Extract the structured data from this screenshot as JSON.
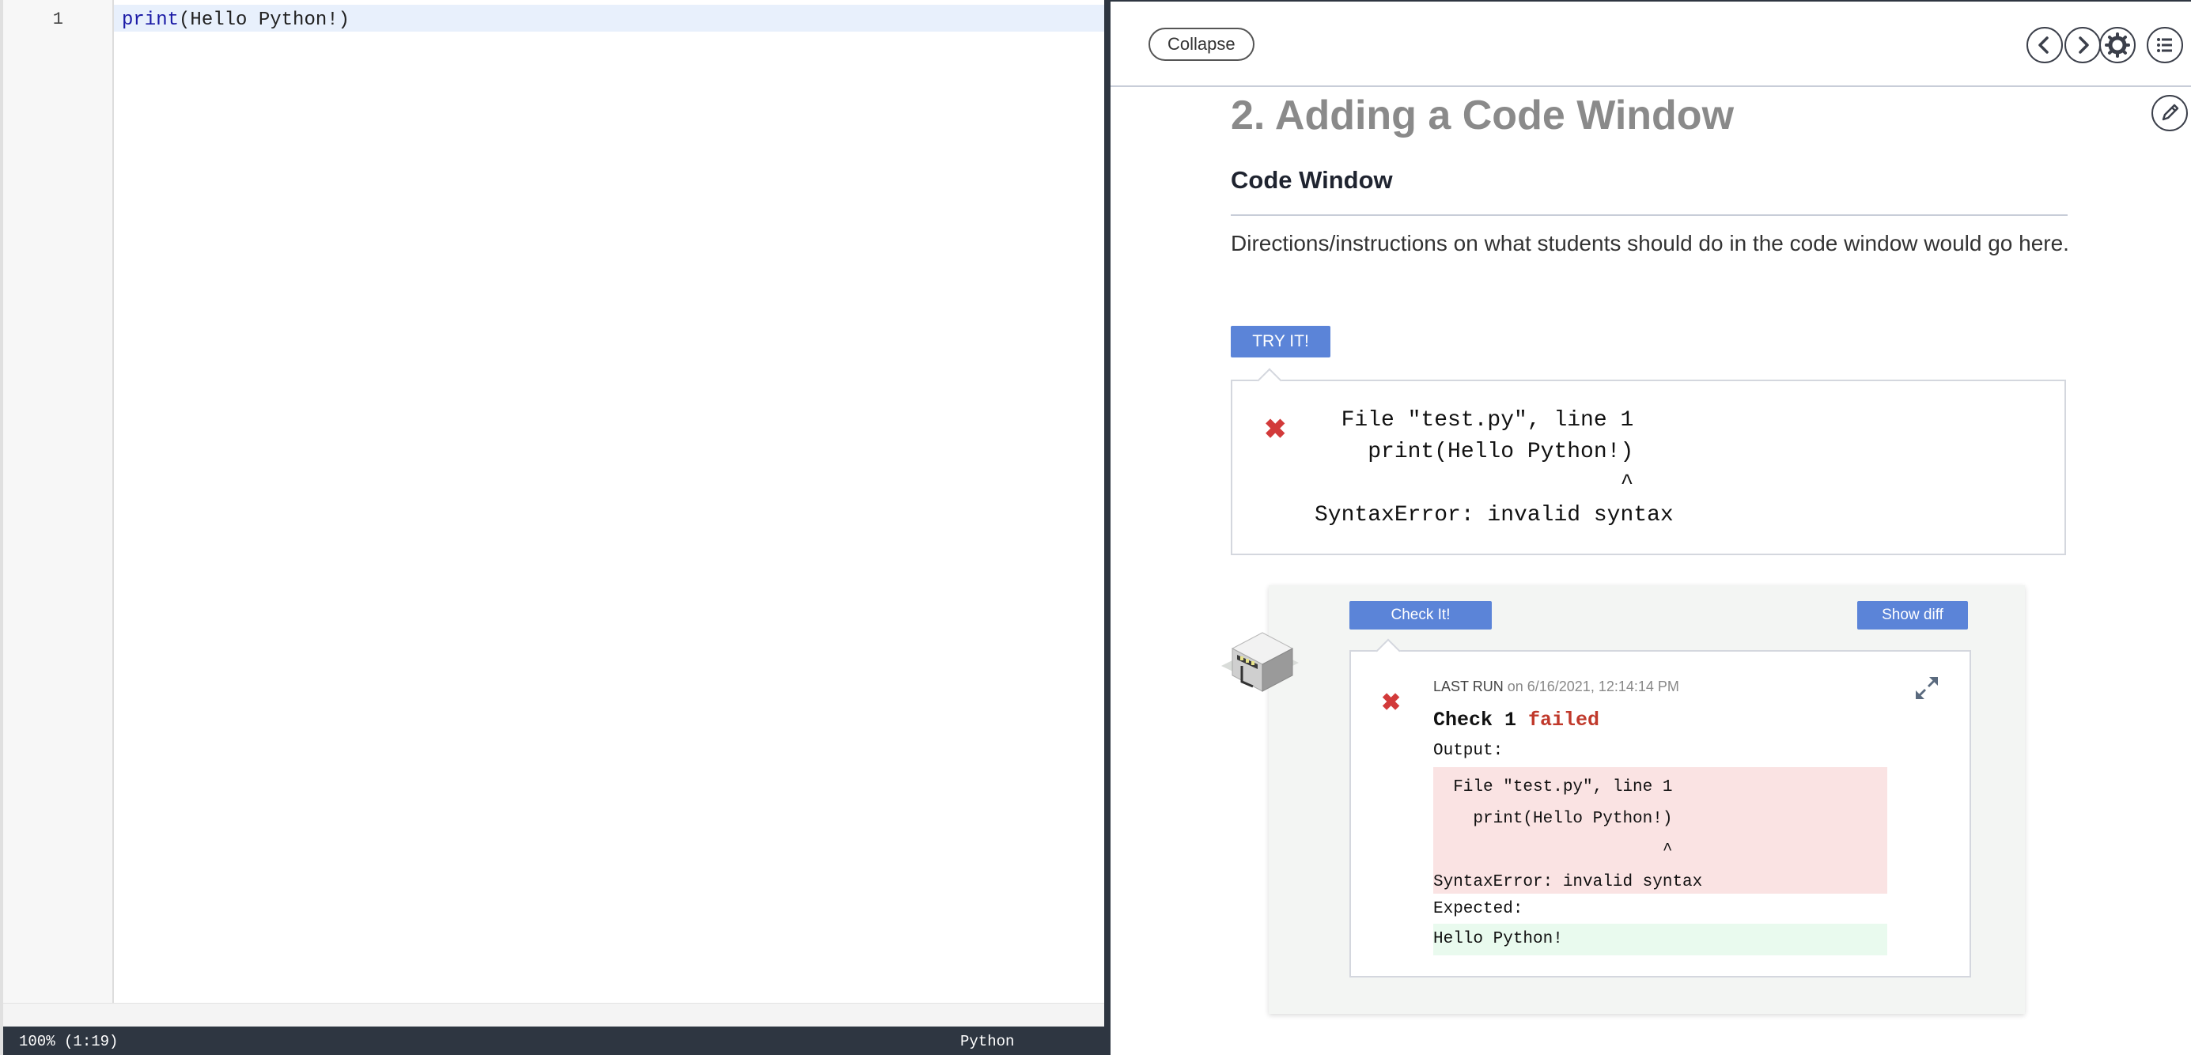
{
  "editor": {
    "line_number": "1",
    "code_keyword": "print",
    "code_rest": "(Hello Python!)",
    "status_zoom": "100%  (1:19)",
    "status_language": "Python"
  },
  "lesson": {
    "collapse_label": "Collapse",
    "section_title": "2. Adding a Code Window",
    "subsection_title": "Code Window",
    "directions": "Directions/instructions on what students should do in the code window would go here.",
    "try_label": "TRY IT!",
    "try_output": "  File \"test.py\", line 1\n    print(Hello Python!)\n                       ^\nSyntaxError: invalid syntax",
    "check_label": "Check It!",
    "diff_label": "Show diff",
    "last_run_label": "LAST RUN",
    "last_run_time": "on 6/16/2021, 12:14:14 PM",
    "check_name": "Check 1",
    "check_status": "failed",
    "output_label": "Output:",
    "output_text": "  File \"test.py\", line 1\n    print(Hello Python!)\n                       ^\nSyntaxError: invalid syntax",
    "expected_label": "Expected:",
    "expected_text": "Hello Python!"
  },
  "icons": {
    "prev": "chevron-left-icon",
    "next": "chevron-right-icon",
    "settings": "gear-icon",
    "toc": "list-icon",
    "edit": "pencil-icon",
    "error": "x-mark-icon",
    "expand": "expand-icon"
  },
  "colors": {
    "accent": "#5b84d8",
    "error": "#d23a3a",
    "statusbar": "#2e3641",
    "output_bg": "#fae3e3",
    "expected_bg": "#e9faee"
  }
}
